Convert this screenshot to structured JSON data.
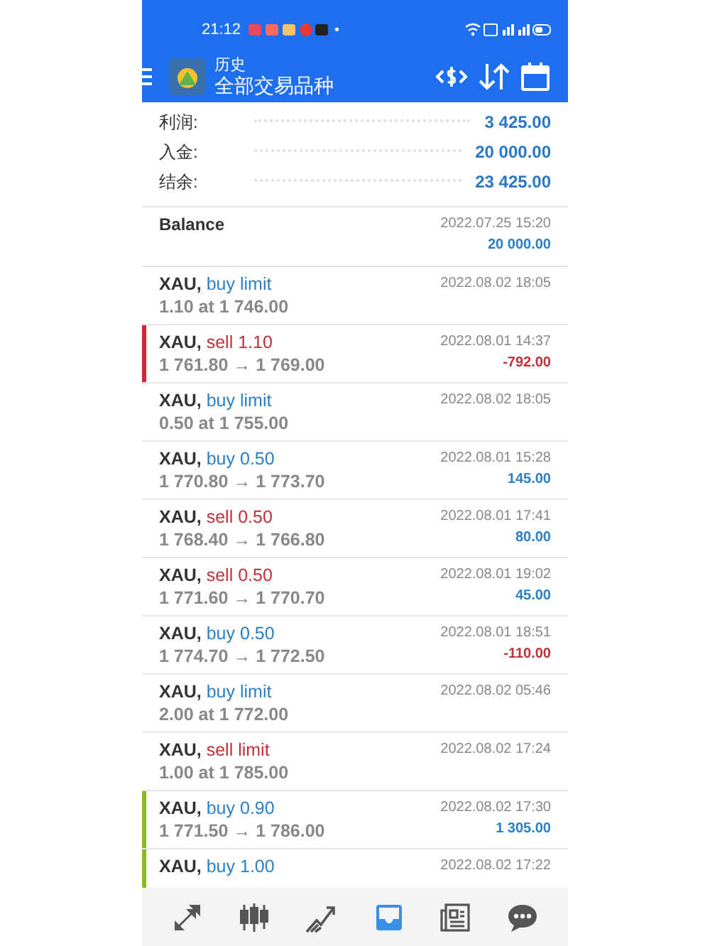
{
  "status_bar": {
    "time": "21:12",
    "more": "•"
  },
  "toolbar": {
    "title": "历史",
    "subtitle": "全部交易品种"
  },
  "summary": [
    {
      "label": "利润:",
      "value": "3 425.00"
    },
    {
      "label": "入金:",
      "value": "20 000.00"
    },
    {
      "label": "结余:",
      "value": "23 425.00"
    }
  ],
  "balance": {
    "label": "Balance",
    "date": "2022.07.25 15:20",
    "amount": "20 000.00"
  },
  "trades": [
    {
      "symbol": "XAU,",
      "action": "buy limit",
      "sell": false,
      "detail": "1.10 at 1 746.00",
      "date": "2022.08.02 18:05"
    },
    {
      "symbol": "XAU,",
      "action": "sell 1.10",
      "sell": true,
      "detail": "1 761.80 → 1 769.00",
      "date": "2022.08.01 14:37",
      "profit": "-792.00",
      "loss": true,
      "color": "#d0263a"
    },
    {
      "symbol": "XAU,",
      "action": "buy limit",
      "sell": false,
      "detail": "0.50 at 1 755.00",
      "date": "2022.08.02 18:05"
    },
    {
      "symbol": "XAU,",
      "action": "buy 0.50",
      "sell": false,
      "detail": "1 770.80 → 1 773.70",
      "date": "2022.08.01 15:28",
      "profit": "145.00",
      "loss": false
    },
    {
      "symbol": "XAU,",
      "action": "sell 0.50",
      "sell": true,
      "detail": "1 768.40 → 1 766.80",
      "date": "2022.08.01 17:41",
      "profit": "80.00",
      "loss": false
    },
    {
      "symbol": "XAU,",
      "action": "sell 0.50",
      "sell": true,
      "detail": "1 771.60 → 1 770.70",
      "date": "2022.08.01 19:02",
      "profit": "45.00",
      "loss": false
    },
    {
      "symbol": "XAU,",
      "action": "buy 0.50",
      "sell": false,
      "detail": "1 774.70 → 1 772.50",
      "date": "2022.08.01 18:51",
      "profit": "-110.00",
      "loss": true
    },
    {
      "symbol": "XAU,",
      "action": "buy limit",
      "sell": false,
      "detail": "2.00 at 1 772.00",
      "date": "2022.08.02 05:46"
    },
    {
      "symbol": "XAU,",
      "action": "sell limit",
      "sell": true,
      "detail": "1.00 at 1 785.00",
      "date": "2022.08.02 17:24"
    },
    {
      "symbol": "XAU,",
      "action": "buy 0.90",
      "sell": false,
      "detail": "1 771.50 → 1 786.00",
      "date": "2022.08.02 17:30",
      "profit": "1 305.00",
      "loss": false,
      "color": "#8bb82a"
    },
    {
      "symbol": "XAU,",
      "action": "buy 1.00",
      "sell": false,
      "date": "2022.08.02 17:22",
      "color": "#8bb82a"
    }
  ],
  "nav": [
    {
      "kind": "trade",
      "selected": false
    },
    {
      "kind": "quotes",
      "selected": false
    },
    {
      "kind": "chart",
      "selected": false
    },
    {
      "kind": "history",
      "selected": true
    },
    {
      "kind": "news",
      "selected": false
    },
    {
      "kind": "chat",
      "selected": false
    }
  ]
}
